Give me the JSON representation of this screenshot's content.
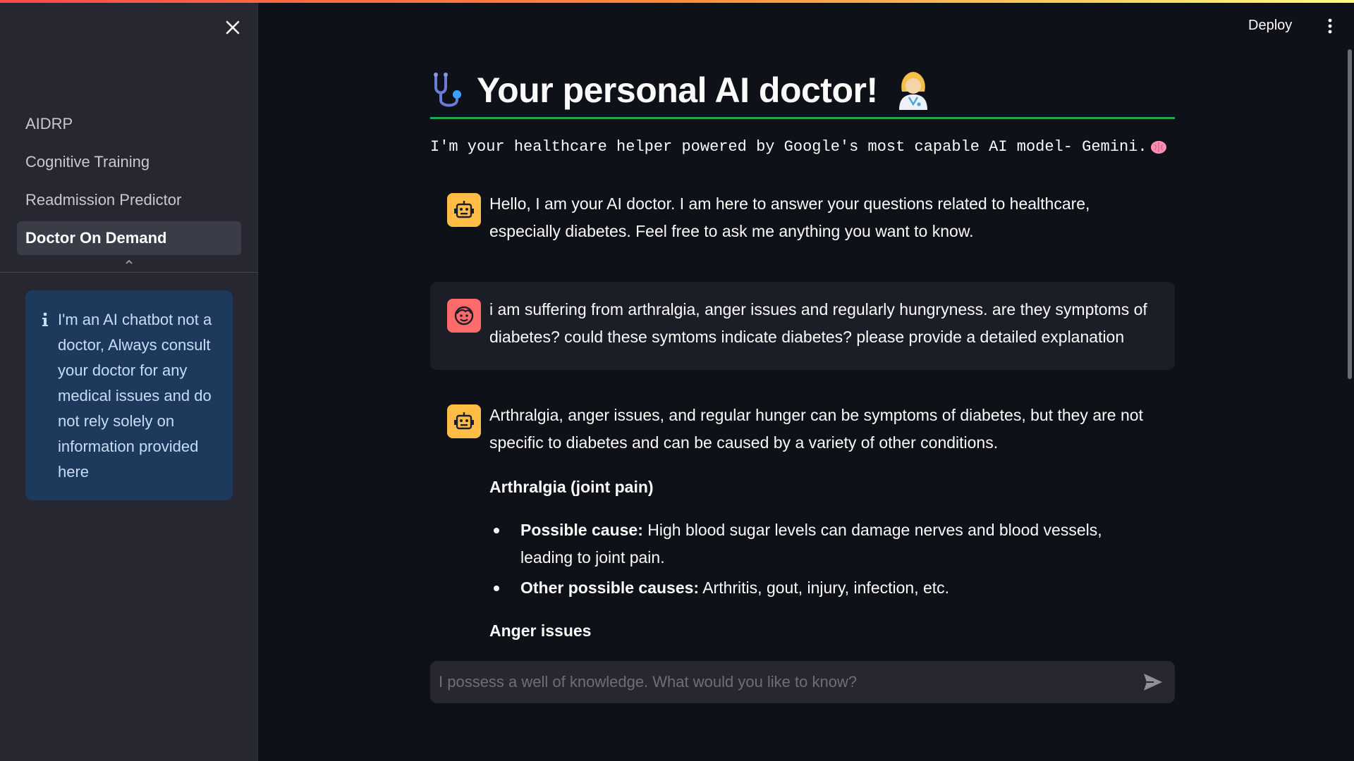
{
  "sidebar": {
    "nav": [
      {
        "label": "AIDRP",
        "active": false
      },
      {
        "label": "Cognitive Training",
        "active": false
      },
      {
        "label": "Readmission Predictor",
        "active": false
      },
      {
        "label": "Doctor On Demand",
        "active": true
      }
    ],
    "info_text": "I'm an AI chatbot not a doctor, Always consult your doctor for any medical issues and do not rely solely on information provided here",
    "icons": {
      "close": "close-icon",
      "collapse": "chevron-up-icon",
      "info": "info-icon"
    }
  },
  "header": {
    "deploy_label": "Deploy",
    "menu_icon": "kebab-menu-icon"
  },
  "page": {
    "title": "Your personal AI doctor!",
    "subtitle": "I'm your healthcare helper powered by Google's most capable AI model- Gemini.",
    "title_icon": "stethoscope-icon",
    "title_emoji": "doctor-emoji-icon",
    "subtitle_emoji": "brain-icon"
  },
  "messages": {
    "m1": {
      "role": "assistant",
      "text": "Hello, I am your AI doctor. I am here to answer your questions related to healthcare, especially diabetes. Feel free to ask me anything you want to know."
    },
    "m2": {
      "role": "user",
      "text": "i am suffering from arthralgia, anger issues and regularly hungryness. are they symptoms of diabetes? could these symtoms indicate diabetes? please provide a detailed explanation"
    },
    "m3": {
      "role": "assistant",
      "intro": "Arthralgia, anger issues, and regular hunger can be symptoms of diabetes, but they are not specific to diabetes and can be caused by a variety of other conditions.",
      "section1_heading": "Arthralgia (joint pain)",
      "bullet1_label": "Possible cause:",
      "bullet1_text": " High blood sugar levels can damage nerves and blood vessels, leading to joint pain.",
      "bullet2_label": "Other possible causes:",
      "bullet2_text": " Arthritis, gout, injury, infection, etc.",
      "section2_heading": "Anger issues"
    }
  },
  "chat_input": {
    "placeholder": "I possess a well of knowledge. What would you like to know?",
    "value": "",
    "send_icon": "send-icon"
  },
  "colors": {
    "background": "#0e1117",
    "sidebar": "#262730",
    "accent_green": "#21a84a",
    "bot_avatar": "#ffbd45",
    "user_avatar": "#ff6b6b",
    "info_box": "#1d3a5c"
  }
}
